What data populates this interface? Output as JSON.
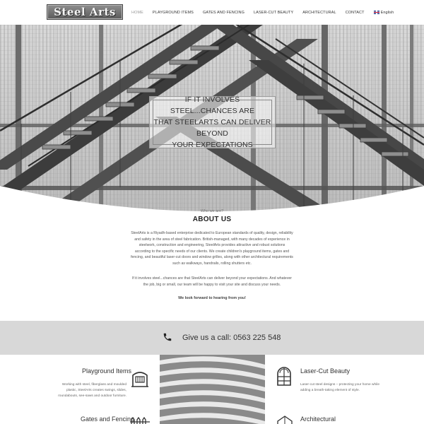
{
  "header": {
    "logo_text": "Steel Arts",
    "nav": [
      {
        "label": "HOME",
        "active": true
      },
      {
        "label": "PLAYGROUND ITEMS",
        "active": false
      },
      {
        "label": "GATES AND FENCING",
        "active": false
      },
      {
        "label": "LASER-CUT BEAUTY",
        "active": false
      },
      {
        "label": "ARCHITECTURAL",
        "active": false
      },
      {
        "label": "CONTACT",
        "active": false
      }
    ],
    "language": "English",
    "language_icon": "uk-flag-icon"
  },
  "hero": {
    "headline_line1": "IF IT INVOLVES STEEL...CHANCES ARE",
    "headline_line2": "THAT STEELARTS CAN DELIVER BEYOND",
    "headline_line3": "YOUR EXPECTATIONS"
  },
  "about": {
    "subtitle": "Who we are?",
    "title": "ABOUT US",
    "paragraph1": "SteelArts is a Riyadh-based enterprise dedicated to European standards of quality, design, reliability and safety in the area of steel fabrication. British-managed, with many decades of experience in steelwork, construction and engineering, SteelArts provides attractive and robust solutions according to the specific needs of our clients. We create children's playground items, gates and fencing, and beautiful laser-cut doors and window grilles, along with other architectural requirements such as walkways, handrails, rolling shutters etc.",
    "paragraph2": "If it involves steel...chances are that SteelArts can deliver beyond your expectations. And whatever the job, big or small, our team will be happy to visit your site and discuss your needs.",
    "closing": "We look forward to hearing from you!"
  },
  "call": {
    "icon": "phone-icon",
    "text": "Give us a call: 0563 225 548"
  },
  "services": {
    "playground": {
      "title": "Playground Items",
      "icon": "playground-icon",
      "desc": "Working with steel, fiberglass and moulded plastic, SteelArts creates swings, slides, roundabouts, see-saws and outdoor furniture."
    },
    "laser": {
      "title": "Laser-Cut Beauty",
      "icon": "arched-window-icon",
      "desc": "Laser-cut steel designs – protecting your home while adding a breath-taking element of style."
    },
    "gates": {
      "title": "Gates and Fencing",
      "icon": "fence-icon"
    },
    "architectural": {
      "title": "Architectural",
      "icon": "arch-building-icon"
    }
  },
  "colors": {
    "call_band": "#d8d8d8",
    "hero_tint": "#cfcfcf",
    "text_dark": "#333333"
  }
}
